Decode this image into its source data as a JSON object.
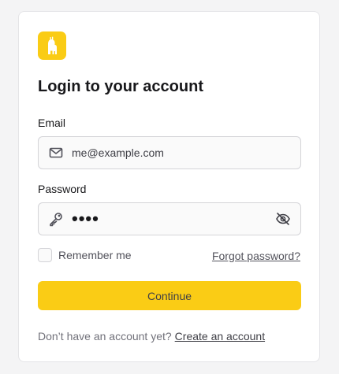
{
  "brand": {
    "logo_icon": "llama-logo-icon",
    "accent": "#facc15"
  },
  "login": {
    "title": "Login to your account",
    "email": {
      "label": "Email",
      "value": "me@example.com",
      "icon": "envelope-icon"
    },
    "password": {
      "label": "Password",
      "value": "••••",
      "icon": "key-icon",
      "toggle_icon": "eye-off-icon"
    },
    "remember_label": "Remember me",
    "remember_checked": false,
    "forgot_link": "Forgot password?",
    "continue_label": "Continue",
    "signup_prompt": "Don’t have an account yet?",
    "signup_link": "Create an account"
  }
}
